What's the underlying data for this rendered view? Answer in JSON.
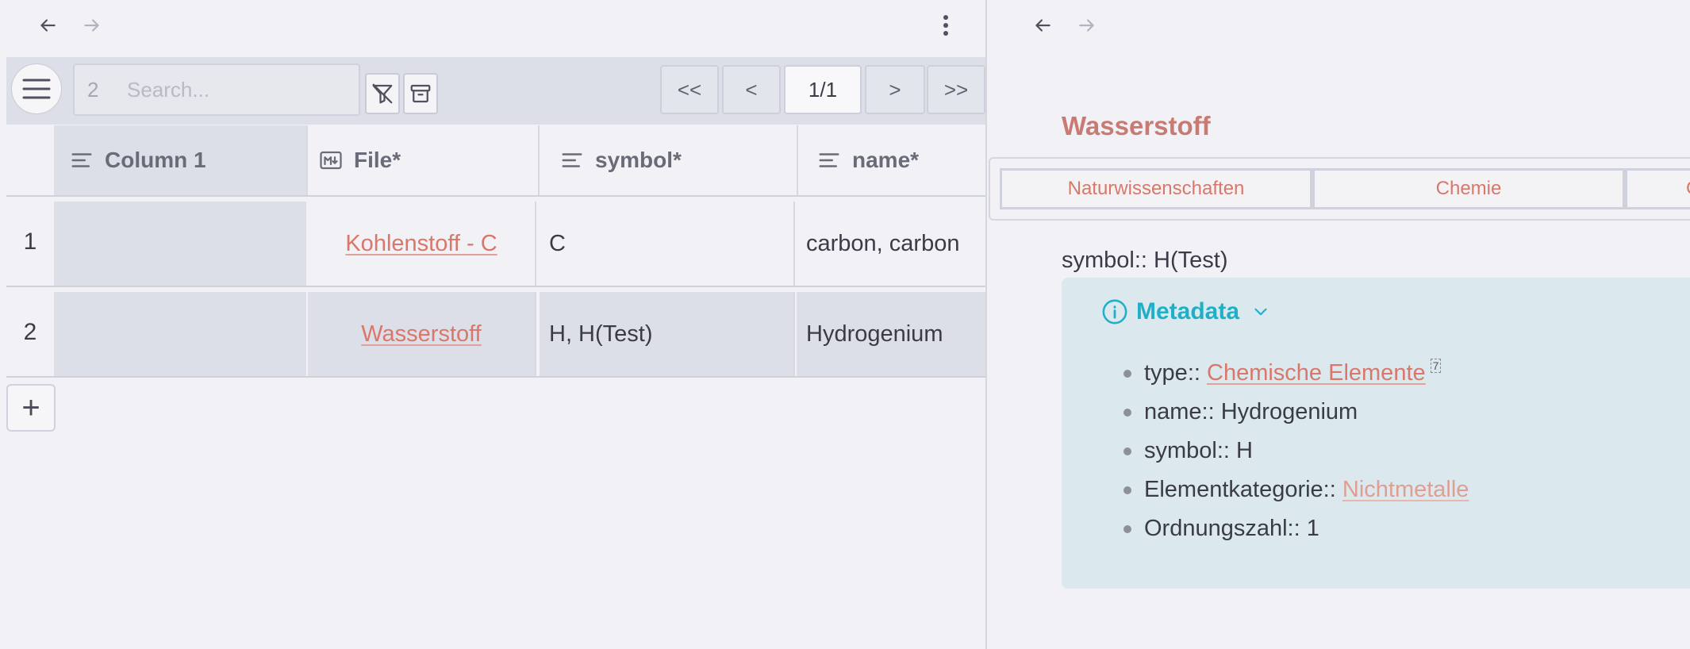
{
  "left": {
    "search": {
      "count": "2",
      "placeholder": "Search..."
    },
    "pagination": {
      "first": "<<",
      "prev": "<",
      "current": "1/1",
      "next": ">",
      "last": ">>"
    },
    "columns": [
      "Column 1",
      "File*",
      "symbol*",
      "name*"
    ],
    "rows": [
      {
        "num": "1",
        "file": "Kohlenstoff - C",
        "symbol": "C",
        "name": "carbon, carbon"
      },
      {
        "num": "2",
        "file": "Wasserstoff",
        "symbol": "H, H(Test)",
        "name": "Hydrogenium"
      }
    ],
    "add_label": "+"
  },
  "right": {
    "title": "Wasserstoff",
    "tags": [
      "Naturwissenschaften",
      "Chemie",
      "C"
    ],
    "symbol_line": "symbol:: H(Test)",
    "callout": {
      "title": "Metadata",
      "items": {
        "type_key": "type:: ",
        "type_val": "Chemische Elemente",
        "type_fn": "7",
        "name": "name:: Hydrogenium",
        "symbol": "symbol:: H",
        "cat_key": "Elementkategorie:: ",
        "cat_val": "Nichtmetalle",
        "order": "Ordnungszahl:: 1"
      }
    }
  },
  "colors": {
    "link": "#d9776a",
    "callout_bg": "#dbe9ef",
    "callout_accent": "#1fb0c8"
  },
  "icons": [
    "arrow-left-icon",
    "arrow-right-icon",
    "more-vertical-icon",
    "menu-icon",
    "filter-off-icon",
    "archive-icon",
    "text-align-icon",
    "markdown-icon",
    "info-icon",
    "chevron-down-icon"
  ]
}
